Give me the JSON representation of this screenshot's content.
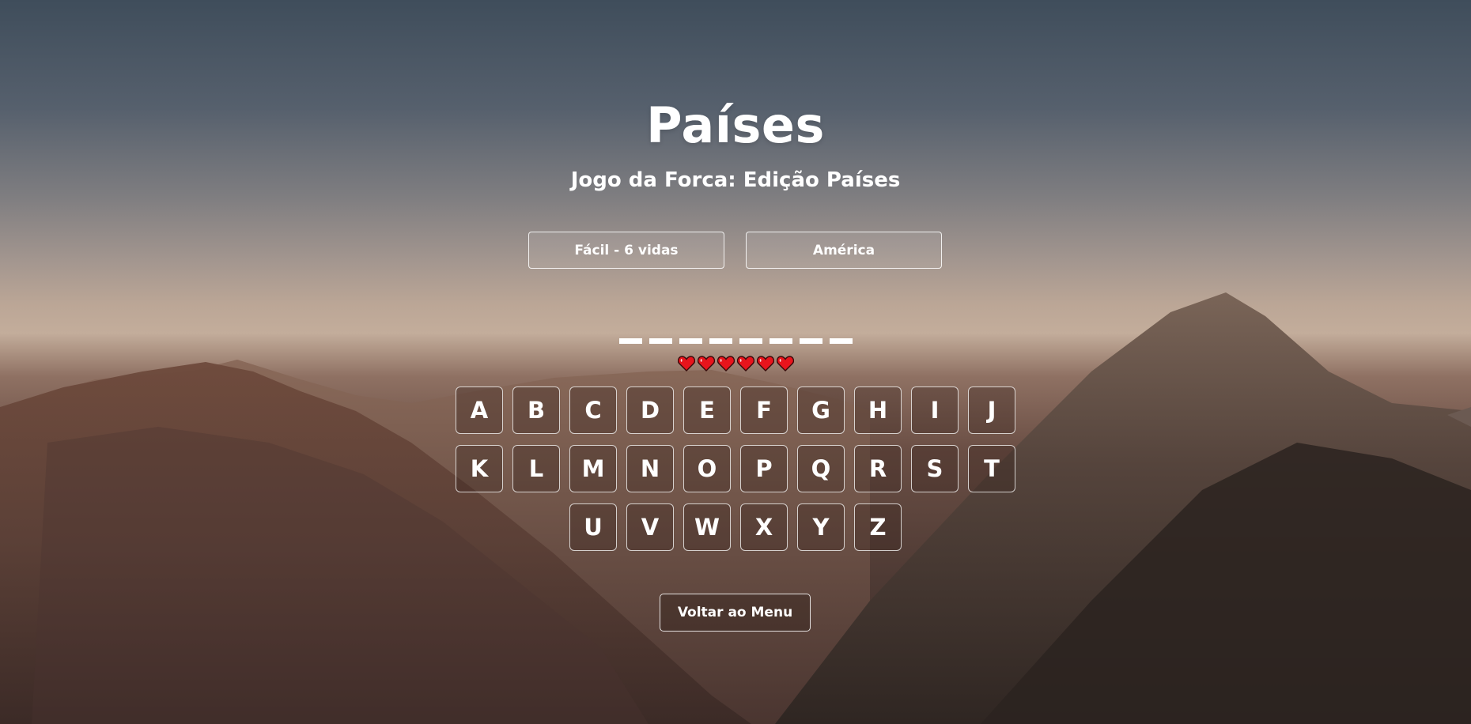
{
  "header": {
    "title": "Países",
    "subtitle": "Jogo da Forca: Edição Países"
  },
  "selectors": {
    "difficulty": "Fácil - 6 vidas",
    "region": "América"
  },
  "word": {
    "letter_count": 8
  },
  "lives": {
    "remaining": 6,
    "icon": "heart-icon",
    "color": "#e8141c"
  },
  "keyboard": {
    "rows": [
      [
        "A",
        "B",
        "C",
        "D",
        "E",
        "F",
        "G",
        "H",
        "I",
        "J"
      ],
      [
        "K",
        "L",
        "M",
        "N",
        "O",
        "P",
        "Q",
        "R",
        "S",
        "T"
      ],
      [
        "U",
        "V",
        "W",
        "X",
        "Y",
        "Z"
      ]
    ]
  },
  "footer": {
    "back_label": "Voltar ao Menu"
  }
}
